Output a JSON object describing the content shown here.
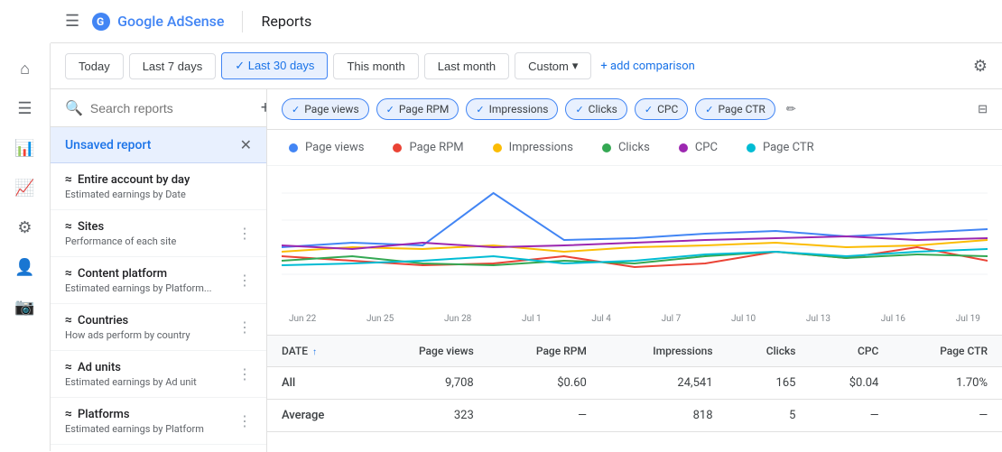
{
  "header": {
    "menu_icon": "☰",
    "brand_name": "Google AdSense",
    "page_title": "Reports"
  },
  "date_filter": {
    "buttons": [
      "Today",
      "Last 7 days",
      "Last 30 days",
      "This month",
      "Last month"
    ],
    "active": "Last 30 days",
    "custom_label": "Custom",
    "add_comparison_label": "+ add comparison"
  },
  "sidebar": {
    "search_placeholder": "Search reports",
    "unsaved_label": "Unsaved report",
    "items": [
      {
        "title": "Entire account by day",
        "subtitle": "Estimated earnings by Date",
        "icon": "≈"
      },
      {
        "title": "Sites",
        "subtitle": "Performance of each site",
        "icon": "≈"
      },
      {
        "title": "Content platform",
        "subtitle": "Estimated earnings by Platform...",
        "icon": "≈"
      },
      {
        "title": "Countries",
        "subtitle": "How ads perform by country",
        "icon": "≈"
      },
      {
        "title": "Ad units",
        "subtitle": "Estimated earnings by Ad unit",
        "icon": "≈"
      },
      {
        "title": "Platforms",
        "subtitle": "Estimated earnings by Platform",
        "icon": "≈"
      }
    ]
  },
  "metrics": {
    "chips": [
      {
        "label": "Page views",
        "color": "#4285f4",
        "active": true
      },
      {
        "label": "Page RPM",
        "color": "#ea4335",
        "active": true
      },
      {
        "label": "Impressions",
        "color": "#fbbc04",
        "active": true
      },
      {
        "label": "Clicks",
        "color": "#34a853",
        "active": true
      },
      {
        "label": "CPC",
        "color": "#9c27b0",
        "active": true
      },
      {
        "label": "Page CTR",
        "color": "#00bcd4",
        "active": true
      }
    ]
  },
  "legend": [
    {
      "label": "Page views",
      "color": "#4285f4"
    },
    {
      "label": "Page RPM",
      "color": "#ea4335"
    },
    {
      "label": "Impressions",
      "color": "#fbbc04"
    },
    {
      "label": "Clicks",
      "color": "#34a853"
    },
    {
      "label": "CPC",
      "color": "#9c27b0"
    },
    {
      "label": "Page CTR",
      "color": "#00bcd4"
    }
  ],
  "x_axis_labels": [
    "Jun 22",
    "Jun 25",
    "Jun 28",
    "Jul 1",
    "Jul 4",
    "Jul 7",
    "Jul 10",
    "Jul 13",
    "Jul 16",
    "Jul 19"
  ],
  "table": {
    "columns": [
      "DATE",
      "Page views",
      "Page RPM",
      "Impressions",
      "Clicks",
      "CPC",
      "Page CTR"
    ],
    "rows": [
      {
        "date": "All",
        "page_views": "9,708",
        "page_rpm": "$0.60",
        "impressions": "24,541",
        "clicks": "165",
        "cpc": "$0.04",
        "page_ctr": "1.70%"
      },
      {
        "date": "Average",
        "page_views": "323",
        "page_rpm": "—",
        "impressions": "818",
        "clicks": "5",
        "cpc": "—",
        "page_ctr": "—"
      }
    ]
  },
  "nav_icons": [
    "home",
    "article",
    "bar_chart",
    "trending_up",
    "settings",
    "camera"
  ],
  "colors": {
    "active_blue": "#1a73e8",
    "light_blue_bg": "#e8f0fe"
  }
}
